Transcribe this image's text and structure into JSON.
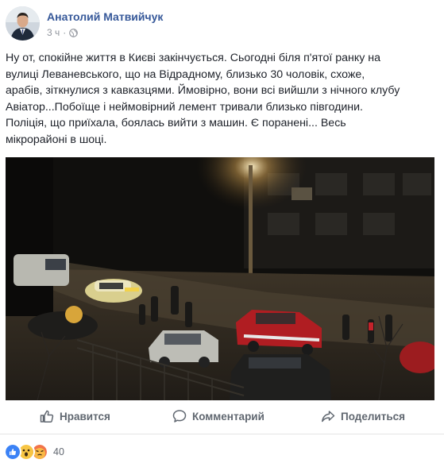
{
  "author": {
    "name": "Анатолий Матвийчук"
  },
  "meta": {
    "time": "3 ч",
    "separator": "·",
    "privacy_icon": "globe-icon"
  },
  "post": {
    "lines": [
      "Ну от, спокійне життя в Києві закінчується. Сьогодні біля п'ятої ранку на",
      "вулиці Леваневського, що на Відрадному, близько 30 чоловік, схоже,",
      "арабів, зіткнулися з кавказцями. Ймовірно, вони всі вийшли з нічного клубу",
      "Авіатор...Побоїще і неймовірний лемент тривали близько півгодини.",
      "Поліція, що приїхала, боялась вийти з машин. Є поранені... Весь",
      "мікрорайоні в шоці."
    ]
  },
  "photo": {
    "description_icon": "night-street-photo"
  },
  "actions": {
    "like": {
      "label": "Нравится",
      "icon": "thumbs-up-icon"
    },
    "comment": {
      "label": "Комментарий",
      "icon": "comment-icon"
    },
    "share": {
      "label": "Поделиться",
      "icon": "share-icon"
    }
  },
  "reactions": {
    "icons": [
      "like-reaction-icon",
      "wow-reaction-icon",
      "angry-reaction-icon"
    ],
    "count": "40"
  },
  "colors": {
    "link": "#365899",
    "muted": "#90949c",
    "action": "#606770",
    "like_blue": "#3b82f6"
  }
}
